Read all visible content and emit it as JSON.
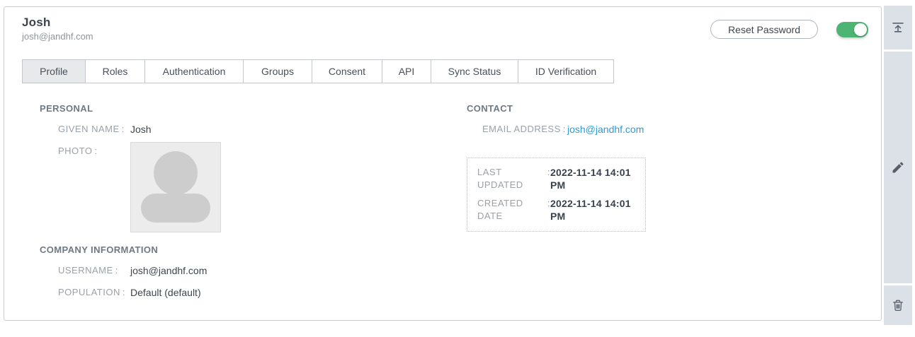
{
  "punct": {
    "colon": ":"
  },
  "user_header": {
    "title": "Josh",
    "email": "josh@jandhf.com",
    "reset_password_button": "Reset Password",
    "enabled_toggle_state": "on"
  },
  "tabs": [
    {
      "label": "Profile",
      "active": true
    },
    {
      "label": "Roles",
      "active": false
    },
    {
      "label": "Authentication",
      "active": false
    },
    {
      "label": "Groups",
      "active": false
    },
    {
      "label": "Consent",
      "active": false
    },
    {
      "label": "API",
      "active": false
    },
    {
      "label": "Sync Status",
      "active": false
    },
    {
      "label": "ID Verification",
      "active": false
    }
  ],
  "personal": {
    "heading": "PERSONAL",
    "given_name": {
      "label": "GIVEN NAME",
      "value": "Josh"
    },
    "photo": {
      "label": "PHOTO"
    }
  },
  "contact": {
    "heading": "CONTACT",
    "email_address": {
      "label": "EMAIL ADDRESS",
      "value": "josh@jandhf.com"
    }
  },
  "timestamps": {
    "last_updated": {
      "label": "LAST UPDATED",
      "value": "2022-11-14 14:01 PM"
    },
    "created_date": {
      "label": "CREATED DATE",
      "value": "2022-11-14 14:01 PM"
    }
  },
  "company": {
    "heading": "COMPANY INFORMATION",
    "username": {
      "label": "USERNAME",
      "value": "josh@jandhf.com"
    },
    "population": {
      "label": "POPULATION",
      "value": "Default (default)"
    }
  },
  "sidebar": {
    "icons": [
      "collapse-top-icon",
      "edit-pencil-icon",
      "trash-icon"
    ]
  },
  "colors": {
    "toggle_green": "#4cb573",
    "link_blue": "#2e9bd6",
    "rail_bg": "#dce1e7",
    "active_tab_bg": "#e7e9eb"
  }
}
